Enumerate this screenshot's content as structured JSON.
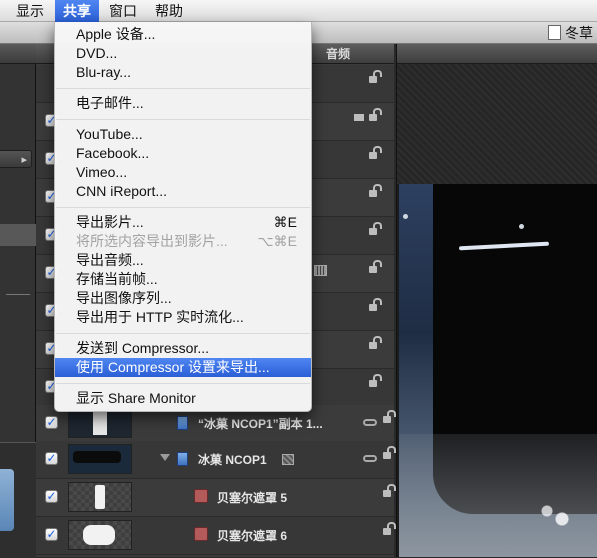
{
  "menubar": {
    "items": [
      "显示",
      "共享",
      "窗口",
      "帮助"
    ],
    "active_index": 1
  },
  "window": {
    "doc_title": "冬草"
  },
  "share_menu": {
    "items": [
      {
        "label": "Apple 设备...",
        "shortcut": "",
        "disabled": false
      },
      {
        "label": "DVD...",
        "shortcut": "",
        "disabled": false
      },
      {
        "label": "Blu-ray...",
        "shortcut": "",
        "disabled": false
      },
      {
        "label": "电子邮件...",
        "shortcut": "",
        "disabled": false
      },
      {
        "label": "YouTube...",
        "shortcut": "",
        "disabled": false
      },
      {
        "label": "Facebook...",
        "shortcut": "",
        "disabled": false
      },
      {
        "label": "Vimeo...",
        "shortcut": "",
        "disabled": false
      },
      {
        "label": "CNN iReport...",
        "shortcut": "",
        "disabled": false
      },
      {
        "label": "导出影片...",
        "shortcut": "⌘E",
        "disabled": false
      },
      {
        "label": "将所选内容导出到影片...",
        "shortcut": "⌥⌘E",
        "disabled": true
      },
      {
        "label": "导出音频...",
        "shortcut": "",
        "disabled": false
      },
      {
        "label": "存储当前帧...",
        "shortcut": "",
        "disabled": false
      },
      {
        "label": "导出图像序列...",
        "shortcut": "",
        "disabled": false
      },
      {
        "label": "导出用于 HTTP 实时流化...",
        "shortcut": "",
        "disabled": false
      },
      {
        "label": "发送到 Compressor...",
        "shortcut": "",
        "disabled": false
      },
      {
        "label": "使用 Compressor 设置来导出...",
        "shortcut": "",
        "disabled": false
      },
      {
        "label": "显示 Share Monitor",
        "shortcut": "",
        "disabled": false
      }
    ],
    "highlighted_index": 15
  },
  "layers_panel": {
    "audio_header": "音频",
    "rows": [
      {
        "name": "“冰菓 NCOP1”副本 1...",
        "checked": true
      },
      {
        "name": "冰菓 NCOP1",
        "checked": true
      },
      {
        "name": "贝塞尔遮罩 5",
        "checked": true
      },
      {
        "name": "贝塞尔遮罩 6",
        "checked": true
      }
    ]
  },
  "icons": {
    "checkbox": "checkmark-icon",
    "lock": "lock-icon",
    "link": "chain-link-icon",
    "layer": "film-layer-icon",
    "mask": "bezier-mask-icon",
    "disclosure": "disclosure-triangle-icon"
  },
  "colors": {
    "menu_highlight": "#2a5fd6",
    "menubar_bg": "#e8e8e8",
    "panel_bg": "#3b3b3b"
  }
}
